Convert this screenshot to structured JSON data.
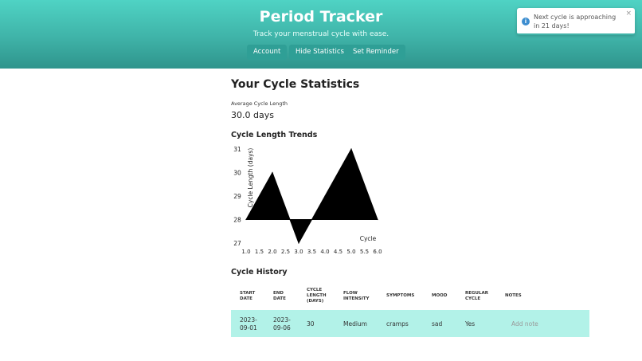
{
  "header": {
    "title": "Period Tracker",
    "tagline": "Track your menstrual cycle with ease.",
    "buttons": [
      "Account",
      "Hide Statistics",
      "Set Reminder"
    ]
  },
  "toast": {
    "message": "Next cycle is approaching in 21 days!",
    "close": "×",
    "icon": "info-icon"
  },
  "statistics": {
    "title": "Your Cycle Statistics",
    "avg_label": "Average Cycle Length",
    "avg_value": "30.0 days"
  },
  "chart_title": "Cycle Length Trends",
  "chart_data": {
    "type": "line",
    "title": "Cycle Length Trends",
    "xlabel": "Cycle",
    "ylabel": "Cycle Length (days)",
    "x": [
      1.0,
      2.0,
      3.0,
      4.0,
      5.0,
      6.0
    ],
    "series": [
      {
        "values": [
          28,
          30,
          27,
          29,
          31,
          28
        ]
      }
    ],
    "xticks": [
      "1.0",
      "1.5",
      "2.0",
      "2.5",
      "3.0",
      "3.5",
      "4.0",
      "4.5",
      "5.0",
      "5.5",
      "6.0"
    ],
    "yticks": [
      "27",
      "28",
      "29",
      "30",
      "31"
    ],
    "xlim": [
      1.0,
      6.0
    ],
    "ylim": [
      27,
      31
    ],
    "fill_color": "#000000"
  },
  "history": {
    "title": "Cycle History",
    "columns": [
      "START DATE",
      "END DATE",
      "CYCLE LENGTH (DAYS)",
      "FLOW INTENSITY",
      "SYMPTOMS",
      "MOOD",
      "REGULAR CYCLE",
      "NOTES"
    ],
    "rows": [
      {
        "start": "2023-09-01",
        "end": "2023-09-06",
        "length": "30",
        "flow": "Medium",
        "symptoms": "cramps",
        "mood": "sad",
        "regular": "Yes",
        "notes": "Add note"
      }
    ]
  }
}
